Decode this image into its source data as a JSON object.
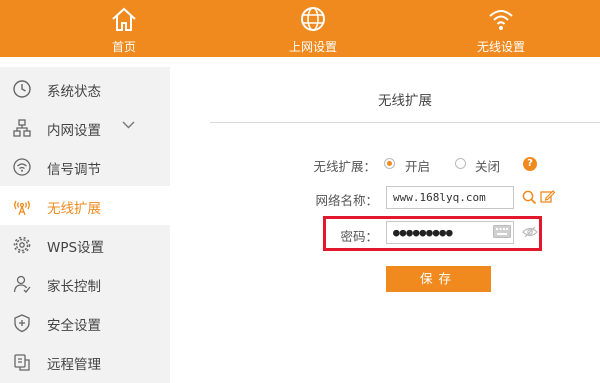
{
  "topnav": {
    "home": "首页",
    "internet": "上网设置",
    "wireless": "无线设置"
  },
  "sidebar": {
    "items": [
      {
        "label": "系统状态",
        "icon": "clock-icon"
      },
      {
        "label": "内网设置",
        "icon": "network-icon"
      },
      {
        "label": "信号调节",
        "icon": "signal-icon"
      },
      {
        "label": "无线扩展",
        "icon": "antenna-icon",
        "active": true
      },
      {
        "label": "WPS设置",
        "icon": "gear-icon"
      },
      {
        "label": "家长控制",
        "icon": "person-icon"
      },
      {
        "label": "安全设置",
        "icon": "shield-icon"
      },
      {
        "label": "远程管理",
        "icon": "remote-icon"
      }
    ]
  },
  "main": {
    "title": "无线扩展",
    "extension_label": "无线扩展：",
    "on_label": "开启",
    "off_label": "关闭",
    "help_glyph": "?",
    "ssid_label": "网络名称：",
    "ssid_value": "www.168lyq.com",
    "password_label": "密码：",
    "password_value": "●●●●●●●●●",
    "save_label": "保存"
  },
  "colors": {
    "accent": "#f08a1e",
    "highlight": "#e2192d"
  }
}
